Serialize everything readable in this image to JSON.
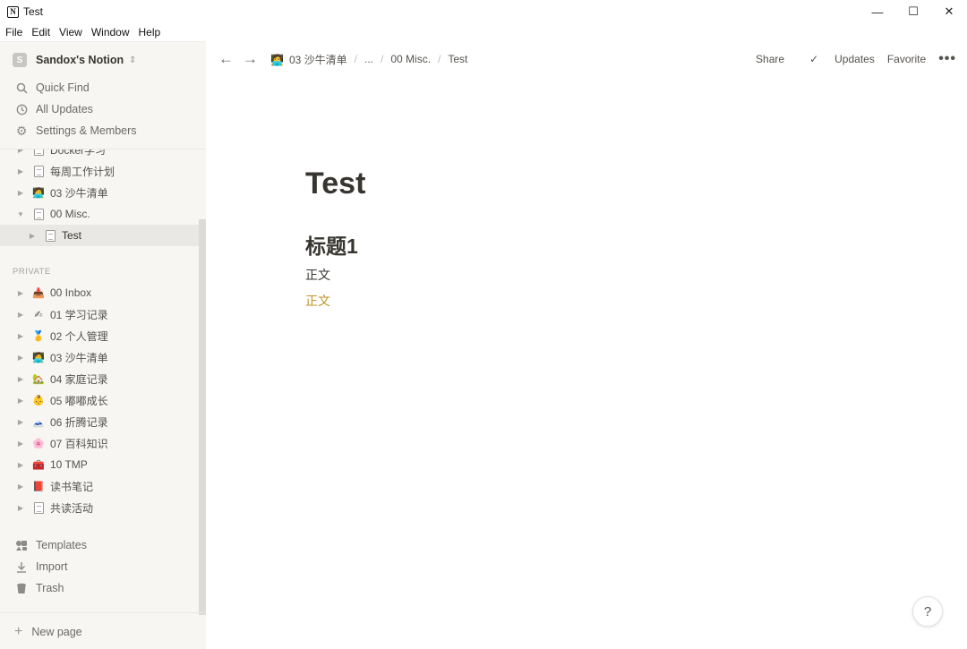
{
  "window": {
    "title": "Test",
    "logo": "N",
    "minimize": "—",
    "maximize": "☐",
    "close": "✕"
  },
  "menu": [
    "File",
    "Edit",
    "View",
    "Window",
    "Help"
  ],
  "sidebar": {
    "workspace_initial": "S",
    "workspace_name": "Sandox's Notion",
    "actions": [
      {
        "icon": "search-icon",
        "label": "Quick Find"
      },
      {
        "icon": "clock-icon",
        "label": "All Updates"
      },
      {
        "icon": "gear-icon",
        "label": "Settings & Members"
      }
    ],
    "workspace_pages": [
      {
        "label": "Docker学习",
        "icon": "doc-icon",
        "expanded": false
      },
      {
        "label": "每周工作计划",
        "icon": "doc-icon",
        "expanded": false
      },
      {
        "label": "03 沙牛清单",
        "icon": "person-emoji",
        "emoji": "🧑‍💻",
        "expanded": false
      },
      {
        "label": "00 Misc.",
        "icon": "doc-icon",
        "expanded": true
      },
      {
        "label": "Test",
        "icon": "doc-icon",
        "expanded": false,
        "active": true
      }
    ],
    "private_label": "PRIVATE",
    "private_pages": [
      {
        "label": "00 Inbox",
        "emoji": "📥",
        "icon": "inbox-emoji"
      },
      {
        "label": "01 学习记录",
        "emoji": "✍",
        "icon": "writing-emoji"
      },
      {
        "label": "02 个人管理",
        "emoji": "🥇",
        "icon": "medal-emoji"
      },
      {
        "label": "03 沙牛清单",
        "emoji": "🧑‍💻",
        "icon": "person-emoji"
      },
      {
        "label": "04 家庭记录",
        "emoji": "🏡",
        "icon": "house-emoji"
      },
      {
        "label": "05 嘟嘟成长",
        "emoji": "👶",
        "icon": "baby-emoji"
      },
      {
        "label": "06 折腾记录",
        "emoji": "🗻",
        "icon": "mountain-emoji"
      },
      {
        "label": "07 百科知识",
        "emoji": "🌸",
        "icon": "flower-emoji"
      },
      {
        "label": "10 TMP",
        "emoji": "🧰",
        "icon": "toolbox-emoji"
      },
      {
        "label": "读书笔记",
        "emoji": "📕",
        "icon": "book-emoji"
      },
      {
        "label": "共读活动",
        "icon": "doc-icon"
      }
    ],
    "bottom_actions": [
      {
        "icon": "templates-icon",
        "label": "Templates"
      },
      {
        "icon": "import-icon",
        "label": "Import"
      },
      {
        "icon": "trash-icon",
        "label": "Trash"
      }
    ],
    "new_page": "New page"
  },
  "topbar": {
    "breadcrumb": [
      {
        "label": "03 沙牛清单",
        "emoji": "🧑‍💻"
      },
      {
        "label": "..."
      },
      {
        "label": "00 Misc."
      },
      {
        "label": "Test"
      }
    ],
    "share": "Share",
    "updates": "Updates",
    "favorite": "Favorite",
    "more": "•••"
  },
  "document": {
    "title": "Test",
    "heading": "标题1",
    "paragraph1": "正文",
    "paragraph2": "正文",
    "paragraph2_color": "#c1922a"
  },
  "help": "?"
}
